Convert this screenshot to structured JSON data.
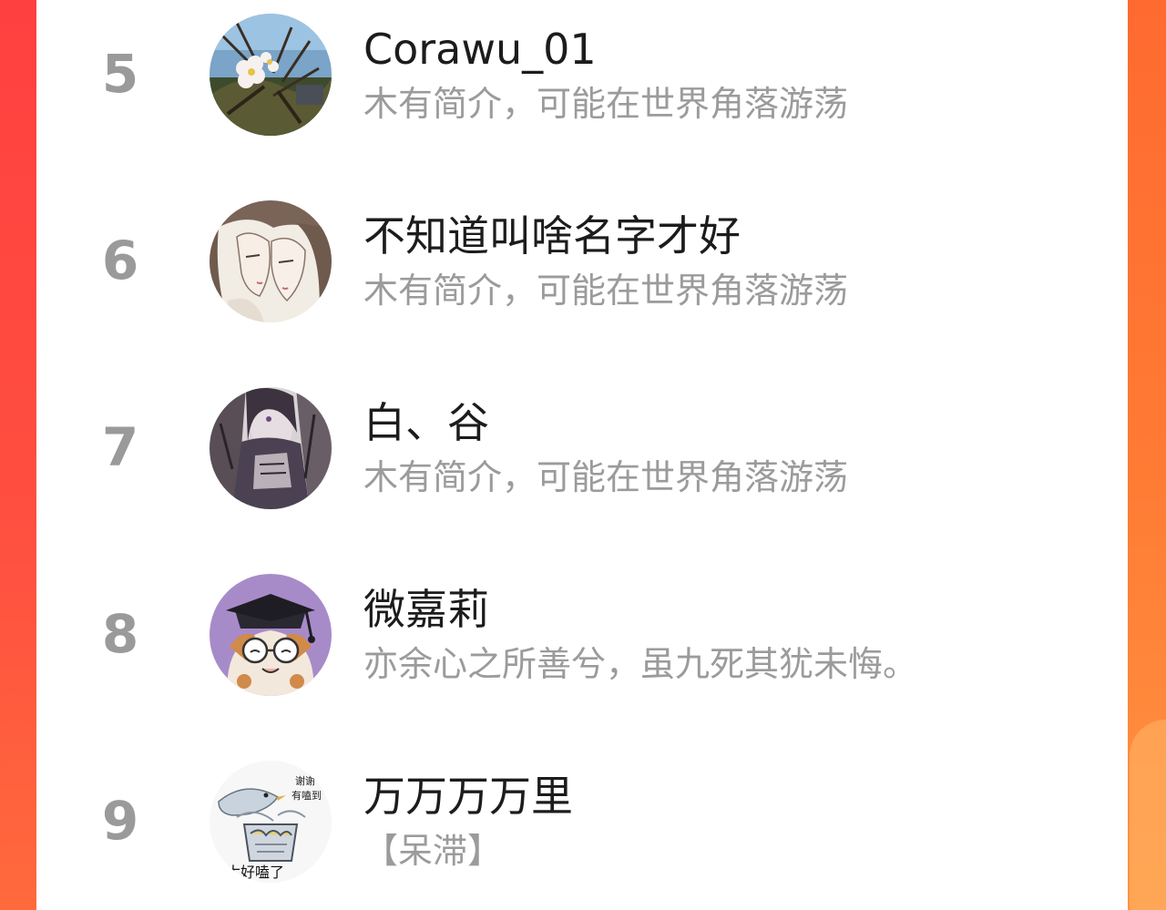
{
  "colors": {
    "accent_left": "#ff4a3a",
    "accent_right": "#ff8a3a",
    "rank_text": "#9a9a9a",
    "name_text": "#1c1c1c",
    "bio_text": "#9b9b9b",
    "panel_bg": "#ffffff"
  },
  "list": {
    "items": [
      {
        "rank": "5",
        "name": "Corawu_01",
        "bio": "木有简介，可能在世界角落游荡",
        "avatar": "avatar-flower-photo"
      },
      {
        "rank": "6",
        "name": "不知道叫啥名字才好",
        "bio": "木有简介，可能在世界角落游荡",
        "avatar": "avatar-illustration-couple"
      },
      {
        "rank": "7",
        "name": "白、谷",
        "bio": "木有简介，可能在世界角落游荡",
        "avatar": "avatar-illustration-character"
      },
      {
        "rank": "8",
        "name": "微嘉莉",
        "bio": "亦余心之所善兮，虽九死其犹未悔。",
        "avatar": "avatar-cartoon-cat"
      },
      {
        "rank": "9",
        "name": "万万万万里",
        "bio": "【呆滞】",
        "avatar": "avatar-sticker-bird",
        "avatar_text": [
          "谢谢",
          "有嗑到",
          "太好嗑了"
        ]
      }
    ]
  }
}
